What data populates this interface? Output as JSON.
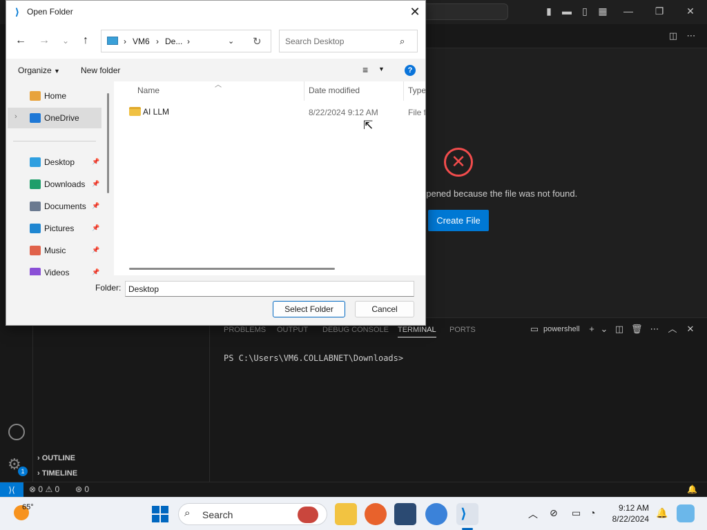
{
  "vscode": {
    "editor": {
      "error_message": "opened because the file was not found.",
      "create_file_label": "Create File"
    },
    "panel": {
      "tabs": [
        "PROBLEMS",
        "OUTPUT",
        "DEBUG CONSOLE",
        "TERMINAL",
        "PORTS"
      ],
      "active_tab": "TERMINAL",
      "shell": "powershell",
      "terminal_prompt": "PS C:\\Users\\VM6.COLLABNET\\Downloads>"
    },
    "sidebar": {
      "sections": [
        "OUTLINE",
        "TIMELINE"
      ]
    },
    "settings_badge": "1",
    "status": {
      "errors": "0",
      "warnings": "0",
      "ports": "0"
    }
  },
  "dialog": {
    "title": "Open Folder",
    "breadcrumb": [
      "VM6",
      "De..."
    ],
    "search_placeholder": "Search Desktop",
    "organize_label": "Organize",
    "new_folder_label": "New folder",
    "nav_items": [
      {
        "label": "Home",
        "icon": "home-icon",
        "color": "#e8a33d",
        "pinned": false
      },
      {
        "label": "OneDrive",
        "icon": "onedrive-icon",
        "color": "#1e78d6",
        "pinned": false
      },
      {
        "label": "Desktop",
        "icon": "desktop-icon",
        "color": "#2f9fe0",
        "pinned": true
      },
      {
        "label": "Downloads",
        "icon": "downloads-icon",
        "color": "#1e9e6a",
        "pinned": true
      },
      {
        "label": "Documents",
        "icon": "documents-icon",
        "color": "#6b7a90",
        "pinned": true
      },
      {
        "label": "Pictures",
        "icon": "pictures-icon",
        "color": "#1f86d1",
        "pinned": true
      },
      {
        "label": "Music",
        "icon": "music-icon",
        "color": "#e0624a",
        "pinned": true
      },
      {
        "label": "Videos",
        "icon": "videos-icon",
        "color": "#8a4fd6",
        "pinned": true
      }
    ],
    "columns": [
      "Name",
      "Date modified",
      "Type"
    ],
    "files": [
      {
        "name": "AI LLM",
        "date": "8/22/2024 9:12 AM",
        "type": "File fo"
      }
    ],
    "folder_label": "Folder:",
    "folder_value": "Desktop",
    "select_label": "Select Folder",
    "cancel_label": "Cancel"
  },
  "taskbar": {
    "temperature": "65°",
    "search_label": "Search",
    "time": "9:12 AM",
    "date": "8/22/2024"
  },
  "colors": {
    "accent": "#0078d4",
    "error": "#f14c4c"
  }
}
